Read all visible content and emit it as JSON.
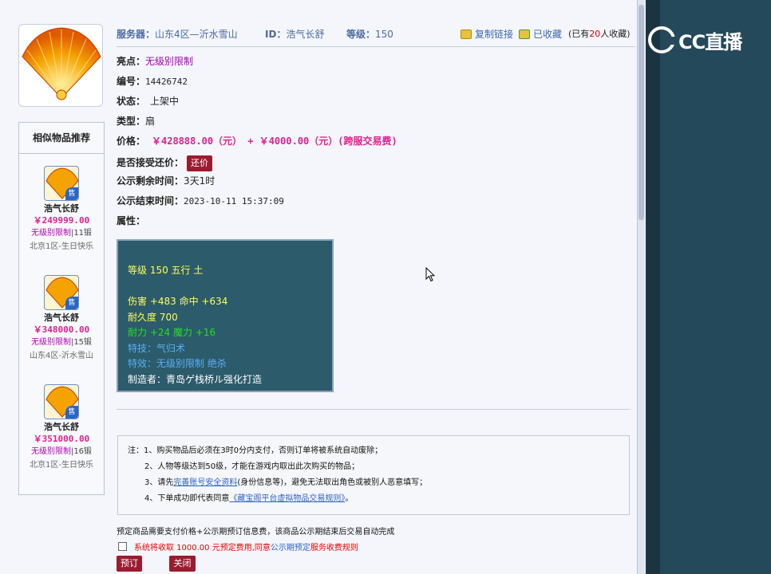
{
  "header": {
    "server_label": "服务器：",
    "server_value": "山东4区—沂水雪山",
    "id_label": "ID：",
    "id_value": "浩气长舒",
    "level_label": "等级：",
    "level_value": "150",
    "copy_link": "复制链接",
    "collected": "已收藏",
    "collect_prefix": "(已有",
    "collect_count": "20",
    "collect_suffix": "人收藏)"
  },
  "logo": {
    "text": "CC直播"
  },
  "info": {
    "highlight_label": "亮点：",
    "highlight_value": "无级别限制",
    "number_label": "编号：",
    "number_value": "14426742",
    "status_label": "状态：",
    "status_value": "上架中",
    "type_label": "类型：",
    "type_value": "扇",
    "price_label": "价格：",
    "price_value": "￥428888.00（元）  +  ￥4000.00（元）(跨服交易费)",
    "bargain_label": "是否接受还价：",
    "bargain_button": "还价",
    "remain_label": "公示剩余时间：",
    "remain_value": "3天1时",
    "end_label": "公示结束时间：",
    "end_value": "2023-10-11 15:37:09",
    "attr_label": "属性："
  },
  "attributes": {
    "line1": "等级 150 五行 土",
    "line2": "伤害 +483 命中 +634",
    "line3": "耐久度 700",
    "line4": "耐力 +24 魔力 +16",
    "line5": "特技：气归术",
    "line6": "特效：无级别限制 绝杀",
    "line7": "制造者：青岛ゲ栈桥ル强化打造"
  },
  "recommend": {
    "title": "相似物品推荐",
    "items": [
      {
        "name": "浩气长舒",
        "price": "￥249999.00",
        "level_a": "无级别限制",
        "level_b": "|11锻",
        "server": "北京1区-生日快乐",
        "badge": "售"
      },
      {
        "name": "浩气长舒",
        "price": "￥348000.00",
        "level_a": "无级别限制",
        "level_b": "|15锻",
        "server": "山东4区-沂水雪山",
        "badge": "售"
      },
      {
        "name": "浩气长舒",
        "price": "￥351000.00",
        "level_a": "无级别限制",
        "level_b": "|16锻",
        "server": "北京1区-生日快乐",
        "badge": "售"
      }
    ]
  },
  "notes": {
    "line1": "注：1、购买物品后必须在3时0分内支付，否则订单将被系统自动废除；",
    "line2": "2、人物等级达到50级，才能在游戏内取出此次购买的物品；",
    "line3_pre": "3、请先",
    "line3_link": "完善账号安全资料",
    "line3_post": "(身份信息等)，避免无法取出角色或被别人恶意填写；",
    "line4_pre": "4、下单成功即代表同意",
    "line4_link": "《藏宝阁平台虚拟物品交易规则》",
    "line4_post": "。"
  },
  "footer": {
    "prepay_note": "预定商品需要支付价格+公示期预订信息费，该商品公示期结束后交易自动完成",
    "agree_red": "系统将收取 1000.00 元预定费用,",
    "agree_mid": "同意",
    "agree_blue": "公示期预定",
    "agree_red2": "服务收费规则",
    "reserve_button": "预订",
    "close_button": "关闭"
  },
  "colors": {
    "accent_red": "#9b1b30",
    "price_pink": "#e0208c",
    "side_panel": "#24495a"
  }
}
